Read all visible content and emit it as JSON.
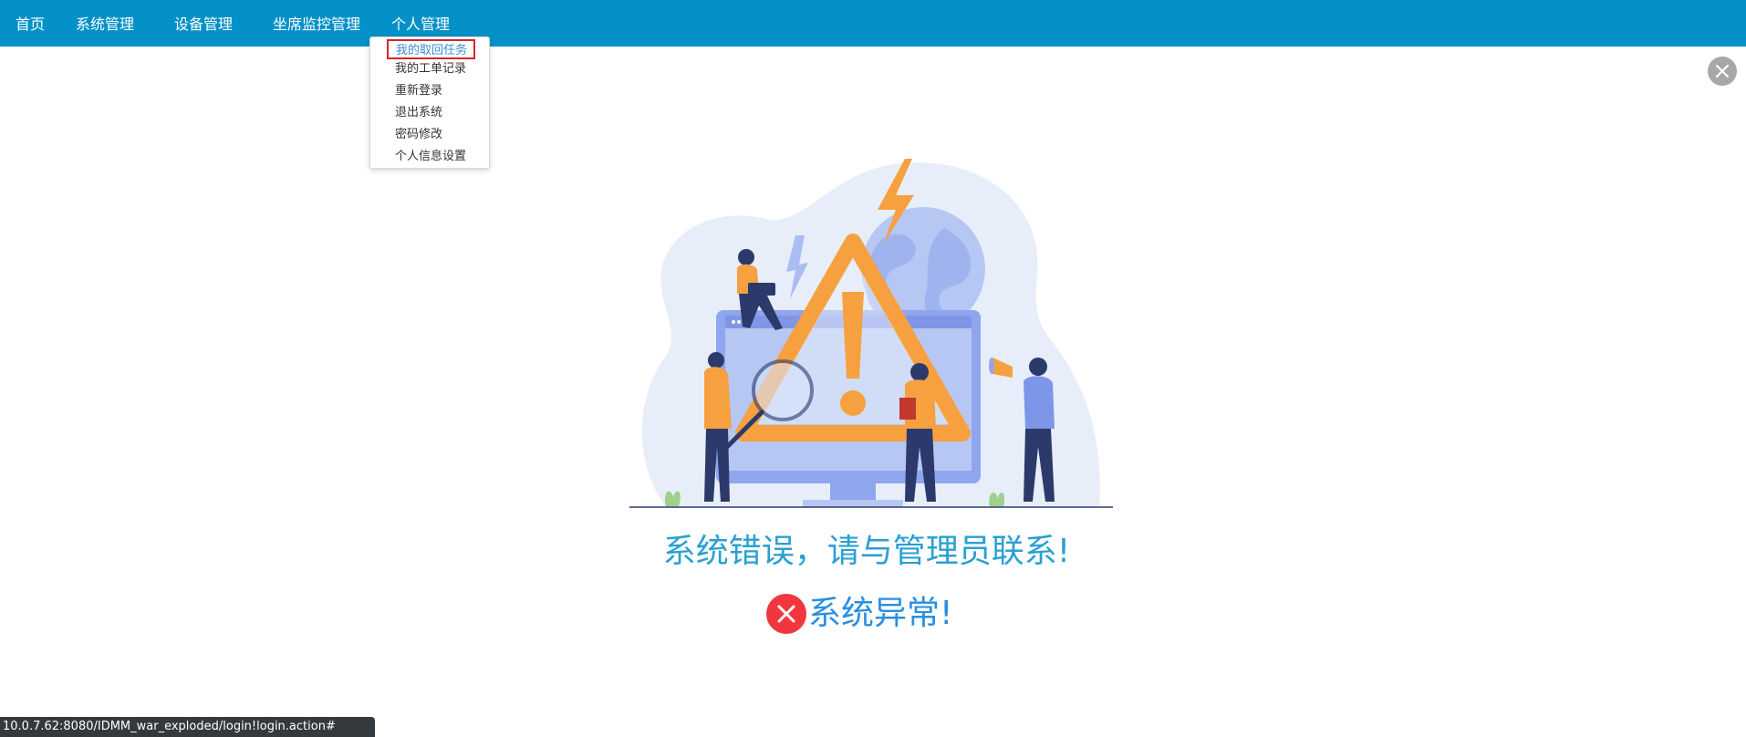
{
  "nav": {
    "items": [
      {
        "label": "首页"
      },
      {
        "label": "系统管理"
      },
      {
        "label": "设备管理"
      },
      {
        "label": "坐席监控管理"
      },
      {
        "label": "个人管理"
      }
    ]
  },
  "dropdown": {
    "items": [
      {
        "label": "我的取回任务",
        "highlighted": true
      },
      {
        "label": "我的工单记录"
      },
      {
        "label": "重新登录"
      },
      {
        "label": "退出系统"
      },
      {
        "label": "密码修改"
      },
      {
        "label": "个人信息设置"
      }
    ]
  },
  "main": {
    "error_title": "系统错误，请与管理员联系!",
    "error_message": "系统异常!"
  },
  "status_bar": {
    "url": "10.0.7.62:8080/IDMM_war_exploded/login!login.action#"
  },
  "icons": {
    "close": "close-icon",
    "error": "error-x-icon",
    "illustration": "warning-illustration"
  },
  "colors": {
    "topbar": "#0391c7",
    "error_title": "#2aa0d2",
    "error_message": "#2a8fe0",
    "error_icon": "#f0373d",
    "dropdown_highlight_border": "#d9232a",
    "illustration_orange": "#f7a040",
    "illustration_blue": "#8fa6ef"
  }
}
